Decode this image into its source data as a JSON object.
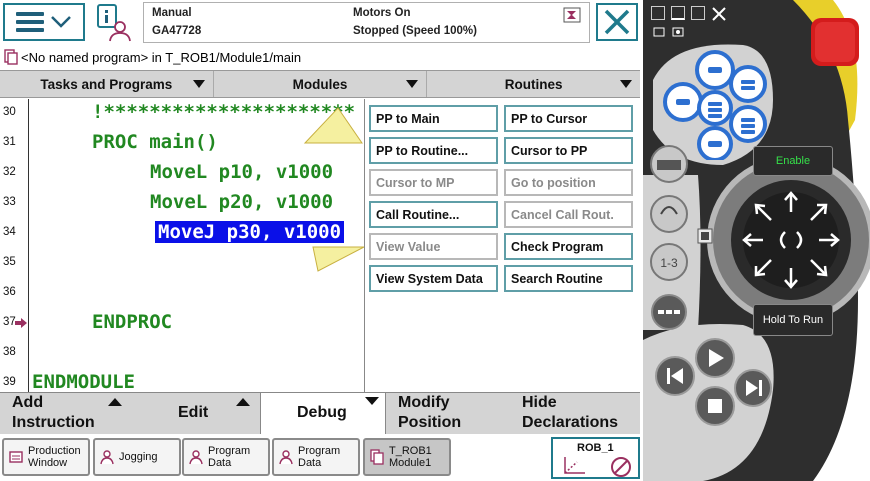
{
  "status": {
    "mode": "Manual",
    "controller": "GA47728",
    "motors": "Motors On",
    "state": "Stopped (Speed 100%)"
  },
  "program_path": "<No named program> in T_ROB1/Module1/main",
  "editor_tabs": [
    "Tasks and Programs",
    "Modules",
    "Routines"
  ],
  "code_lines": [
    {
      "no": "30",
      "text": "!**********************"
    },
    {
      "no": "31",
      "text": "PROC main()"
    },
    {
      "no": "32",
      "text": "MoveL p10, v1000"
    },
    {
      "no": "33",
      "text": "MoveL p20, v1000"
    },
    {
      "no": "34",
      "text": "MoveJ p30, v1000"
    },
    {
      "no": "35",
      "text": ""
    },
    {
      "no": "36",
      "text": ""
    },
    {
      "no": "37",
      "text": "ENDPROC"
    },
    {
      "no": "38",
      "text": ""
    },
    {
      "no": "39",
      "text": "ENDMODULE"
    }
  ],
  "debug_menu": [
    {
      "label": "PP to Main",
      "enabled": true
    },
    {
      "label": "PP to Cursor",
      "enabled": true
    },
    {
      "label": "PP to Routine...",
      "enabled": true
    },
    {
      "label": "Cursor to PP",
      "enabled": true
    },
    {
      "label": "Cursor to MP",
      "enabled": false
    },
    {
      "label": "Go to position",
      "enabled": false
    },
    {
      "label": "Call Routine...",
      "enabled": true
    },
    {
      "label": "Cancel Call Rout.",
      "enabled": false
    },
    {
      "label": "View Value",
      "enabled": false
    },
    {
      "label": "Check Program",
      "enabled": true
    },
    {
      "label": "View System Data",
      "enabled": true
    },
    {
      "label": "Search Routine",
      "enabled": true
    }
  ],
  "commands": {
    "add_instruction": [
      "Add",
      "Instruction"
    ],
    "edit": "Edit",
    "debug": "Debug",
    "modify_position": [
      "Modify",
      "Position"
    ],
    "hide_declarations": [
      "Hide",
      "Declarations"
    ]
  },
  "taskbar": [
    {
      "label": [
        "Production",
        "Window"
      ]
    },
    {
      "label": [
        "Jogging"
      ]
    },
    {
      "label": [
        "Program",
        "Data"
      ]
    },
    {
      "label": [
        "Program",
        "Data"
      ]
    },
    {
      "label": [
        "T_ROB1",
        "Module1"
      ]
    }
  ],
  "robot": "ROB_1",
  "pendant": {
    "enable_label": "Enable",
    "hold_to_run_label": "Hold To Run"
  },
  "colors": {
    "code_green": "#218821",
    "selection_blue": "#0a10e8",
    "accent_teal": "#1f7a8c",
    "pendant_body": "#2b2b2b",
    "pendant_yellow": "#e8cf2a",
    "estop_red": "#d41c1c"
  }
}
